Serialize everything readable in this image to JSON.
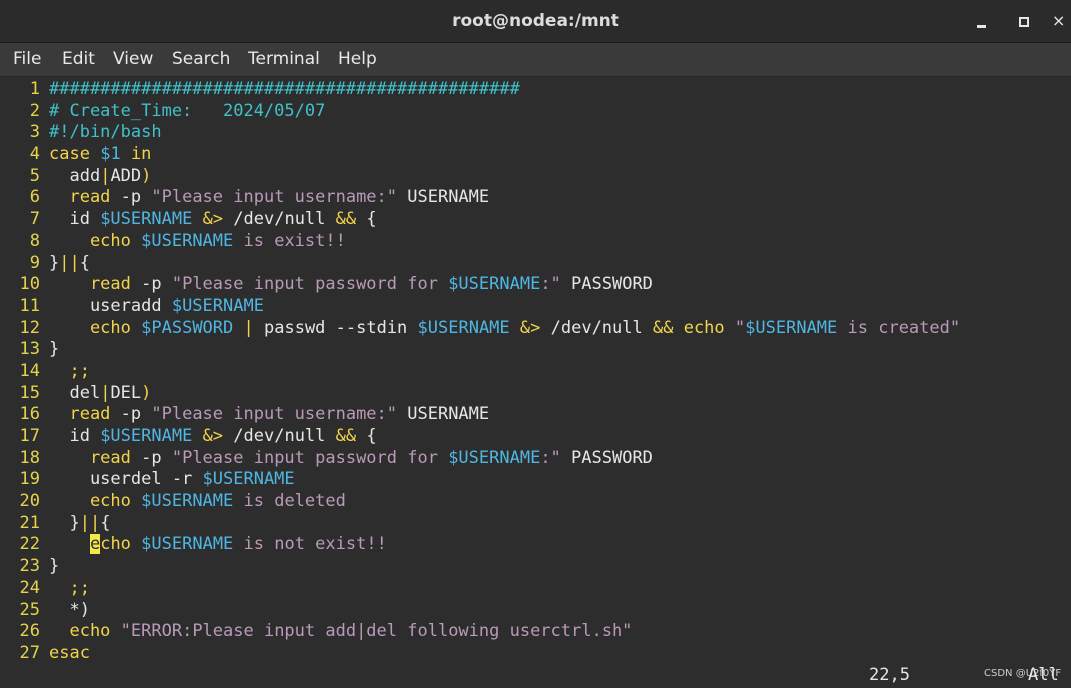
{
  "window": {
    "title": "root@nodea:/mnt",
    "minimize_icon": "minimize-icon",
    "maximize_icon": "maximize-icon",
    "close_icon": "close-icon",
    "close_glyph": "×"
  },
  "menu": [
    "File",
    "Edit",
    "View",
    "Search",
    "Terminal",
    "Help"
  ],
  "colors": {
    "text": "#e6e6e6",
    "line_number": "#e5d44b",
    "keyword": "#f2d44b",
    "comment": "#3fc1c9",
    "string": "#b99ab8",
    "variable": "#4fb6e3",
    "background": "#2d2d2d"
  },
  "lines": [
    {
      "n": "1",
      "segs": [
        {
          "t": "cm",
          "s": "##############################################"
        }
      ]
    },
    {
      "n": "2",
      "segs": [
        {
          "t": "cm",
          "s": "# Create_Time:   2024/05/07"
        }
      ]
    },
    {
      "n": "3",
      "segs": [
        {
          "t": "cm",
          "s": "#!/bin/bash"
        }
      ]
    },
    {
      "n": "4",
      "segs": [
        {
          "t": "kw",
          "s": "case"
        },
        {
          "t": "tx",
          "s": " "
        },
        {
          "t": "vr",
          "s": "$1"
        },
        {
          "t": "tx",
          "s": " "
        },
        {
          "t": "kw",
          "s": "in"
        }
      ]
    },
    {
      "n": "5",
      "segs": [
        {
          "t": "tx",
          "s": "  add"
        },
        {
          "t": "kw",
          "s": "|"
        },
        {
          "t": "tx",
          "s": "ADD"
        },
        {
          "t": "kw",
          "s": ")"
        }
      ]
    },
    {
      "n": "6",
      "segs": [
        {
          "t": "kw",
          "s": "  read"
        },
        {
          "t": "tx",
          "s": " -p "
        },
        {
          "t": "st",
          "s": "\"Please input username:\""
        },
        {
          "t": "tx",
          "s": " USERNAME"
        }
      ]
    },
    {
      "n": "7",
      "segs": [
        {
          "t": "tx",
          "s": "  id "
        },
        {
          "t": "vr",
          "s": "$USERNAME"
        },
        {
          "t": "tx",
          "s": " "
        },
        {
          "t": "kw",
          "s": "&>"
        },
        {
          "t": "tx",
          "s": " /dev/null "
        },
        {
          "t": "kw",
          "s": "&&"
        },
        {
          "t": "tx",
          "s": " {"
        }
      ]
    },
    {
      "n": "8",
      "segs": [
        {
          "t": "kw",
          "s": "    echo"
        },
        {
          "t": "tx",
          "s": " "
        },
        {
          "t": "vr",
          "s": "$USERNAME"
        },
        {
          "t": "st",
          "s": " is exist!!"
        }
      ]
    },
    {
      "n": "9",
      "segs": [
        {
          "t": "tx",
          "s": "}"
        },
        {
          "t": "kw",
          "s": "||"
        },
        {
          "t": "tx",
          "s": "{"
        }
      ]
    },
    {
      "n": "10",
      "segs": [
        {
          "t": "kw",
          "s": "    read"
        },
        {
          "t": "tx",
          "s": " -p "
        },
        {
          "t": "st",
          "s": "\"Please input password for "
        },
        {
          "t": "vr",
          "s": "$USERNAME"
        },
        {
          "t": "st",
          "s": ":\""
        },
        {
          "t": "tx",
          "s": " PASSWORD"
        }
      ]
    },
    {
      "n": "11",
      "segs": [
        {
          "t": "tx",
          "s": "    useradd "
        },
        {
          "t": "vr",
          "s": "$USERNAME"
        }
      ]
    },
    {
      "n": "12",
      "segs": [
        {
          "t": "kw",
          "s": "    echo"
        },
        {
          "t": "tx",
          "s": " "
        },
        {
          "t": "vr",
          "s": "$PASSWORD"
        },
        {
          "t": "tx",
          "s": " "
        },
        {
          "t": "kw",
          "s": "|"
        },
        {
          "t": "tx",
          "s": " passwd --stdin "
        },
        {
          "t": "vr",
          "s": "$USERNAME"
        },
        {
          "t": "tx",
          "s": " "
        },
        {
          "t": "kw",
          "s": "&>"
        },
        {
          "t": "tx",
          "s": " /dev/null "
        },
        {
          "t": "kw",
          "s": "&&"
        },
        {
          "t": "kw",
          "s": " echo"
        },
        {
          "t": "tx",
          "s": " "
        },
        {
          "t": "st",
          "s": "\""
        },
        {
          "t": "vr",
          "s": "$USERNAME"
        },
        {
          "t": "st",
          "s": " is created\""
        }
      ]
    },
    {
      "n": "13",
      "segs": [
        {
          "t": "tx",
          "s": "}"
        }
      ]
    },
    {
      "n": "14",
      "segs": [
        {
          "t": "kw",
          "s": "  ;;"
        }
      ]
    },
    {
      "n": "15",
      "segs": [
        {
          "t": "tx",
          "s": "  del"
        },
        {
          "t": "kw",
          "s": "|"
        },
        {
          "t": "tx",
          "s": "DEL"
        },
        {
          "t": "kw",
          "s": ")"
        }
      ]
    },
    {
      "n": "16",
      "segs": [
        {
          "t": "kw",
          "s": "  read"
        },
        {
          "t": "tx",
          "s": " -p "
        },
        {
          "t": "st",
          "s": "\"Please input username:\""
        },
        {
          "t": "tx",
          "s": " USERNAME"
        }
      ]
    },
    {
      "n": "17",
      "segs": [
        {
          "t": "tx",
          "s": "  id "
        },
        {
          "t": "vr",
          "s": "$USERNAME"
        },
        {
          "t": "tx",
          "s": " "
        },
        {
          "t": "kw",
          "s": "&>"
        },
        {
          "t": "tx",
          "s": " /dev/null "
        },
        {
          "t": "kw",
          "s": "&&"
        },
        {
          "t": "tx",
          "s": " {"
        }
      ]
    },
    {
      "n": "18",
      "segs": [
        {
          "t": "kw",
          "s": "    read"
        },
        {
          "t": "tx",
          "s": " -p "
        },
        {
          "t": "st",
          "s": "\"Please input password for "
        },
        {
          "t": "vr",
          "s": "$USERNAME"
        },
        {
          "t": "st",
          "s": ":\""
        },
        {
          "t": "tx",
          "s": " PASSWORD"
        }
      ]
    },
    {
      "n": "19",
      "segs": [
        {
          "t": "tx",
          "s": "    userdel -r "
        },
        {
          "t": "vr",
          "s": "$USERNAME"
        }
      ]
    },
    {
      "n": "20",
      "segs": [
        {
          "t": "kw",
          "s": "    echo"
        },
        {
          "t": "tx",
          "s": " "
        },
        {
          "t": "vr",
          "s": "$USERNAME"
        },
        {
          "t": "st",
          "s": " is deleted"
        }
      ]
    },
    {
      "n": "21",
      "segs": [
        {
          "t": "tx",
          "s": "  }"
        },
        {
          "t": "kw",
          "s": "||"
        },
        {
          "t": "tx",
          "s": "{"
        }
      ]
    },
    {
      "n": "22",
      "segs": [
        {
          "t": "tx",
          "s": "    "
        },
        {
          "t": "cursor",
          "s": "e"
        },
        {
          "t": "kw",
          "s": "cho"
        },
        {
          "t": "tx",
          "s": " "
        },
        {
          "t": "vr",
          "s": "$USERNAME"
        },
        {
          "t": "st",
          "s": " is not exist!!"
        }
      ]
    },
    {
      "n": "23",
      "segs": [
        {
          "t": "tx",
          "s": "}"
        }
      ]
    },
    {
      "n": "24",
      "segs": [
        {
          "t": "kw",
          "s": "  ;;"
        }
      ]
    },
    {
      "n": "25",
      "segs": [
        {
          "t": "tx",
          "s": "  *)"
        }
      ]
    },
    {
      "n": "26",
      "segs": [
        {
          "t": "kw",
          "s": "  echo"
        },
        {
          "t": "tx",
          "s": " "
        },
        {
          "t": "st",
          "s": "\"ERROR:Please input add|del following userctrl.sh\""
        }
      ]
    },
    {
      "n": "27",
      "segs": [
        {
          "t": "kw",
          "s": "esac"
        }
      ]
    }
  ],
  "status": {
    "position": "22,5",
    "scroll": "All",
    "watermark": "CSDN @U2f0YF"
  }
}
